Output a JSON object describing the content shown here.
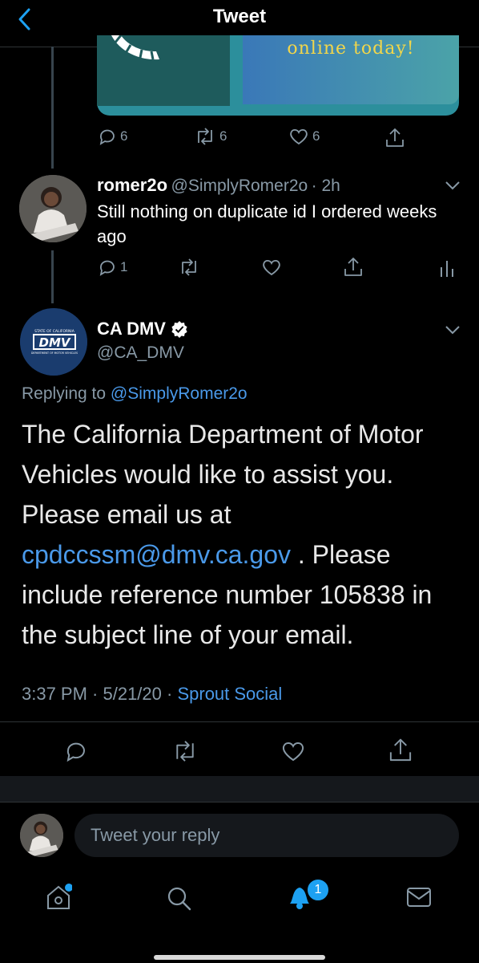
{
  "header": {
    "title": "Tweet",
    "back_icon": "chevron-left-icon"
  },
  "previous_tweet": {
    "media_text": "online today!",
    "actions": {
      "replies": "6",
      "retweets": "6",
      "likes": "6"
    }
  },
  "reply_tweet": {
    "name": "romer2o",
    "handle": "@SimplyRomer2o",
    "time": "· 2h",
    "text": "Still nothing on duplicate id I ordered weeks ago",
    "actions": {
      "replies": "1"
    }
  },
  "main_tweet": {
    "name": "CA DMV",
    "handle": "@CA_DMV",
    "replying_to_label": "Replying to",
    "replying_to_handle": "@SimplyRomer2o",
    "text_part1": "The California Department of Motor Vehicles would like to assist you. Please email us at ",
    "link": "cpdccssm@dmv.ca.gov",
    "text_part2": " . Please include reference number 105838 in the subject line of your email.",
    "timestamp": "3:37 PM · 5/21/20 ·",
    "source": "Sprout Social",
    "logo_line1": "STATE OF CALIFORNIA",
    "logo_line2": "DMV",
    "logo_line3": "DEPARTMENT OF MOTOR VEHICLES"
  },
  "compose": {
    "placeholder": "Tweet your reply"
  },
  "tabbar": {
    "notifications_badge": "1"
  },
  "colors": {
    "accent": "#1da1f2",
    "link": "#4a99e9",
    "muted": "#8899a6",
    "background": "#000000"
  }
}
